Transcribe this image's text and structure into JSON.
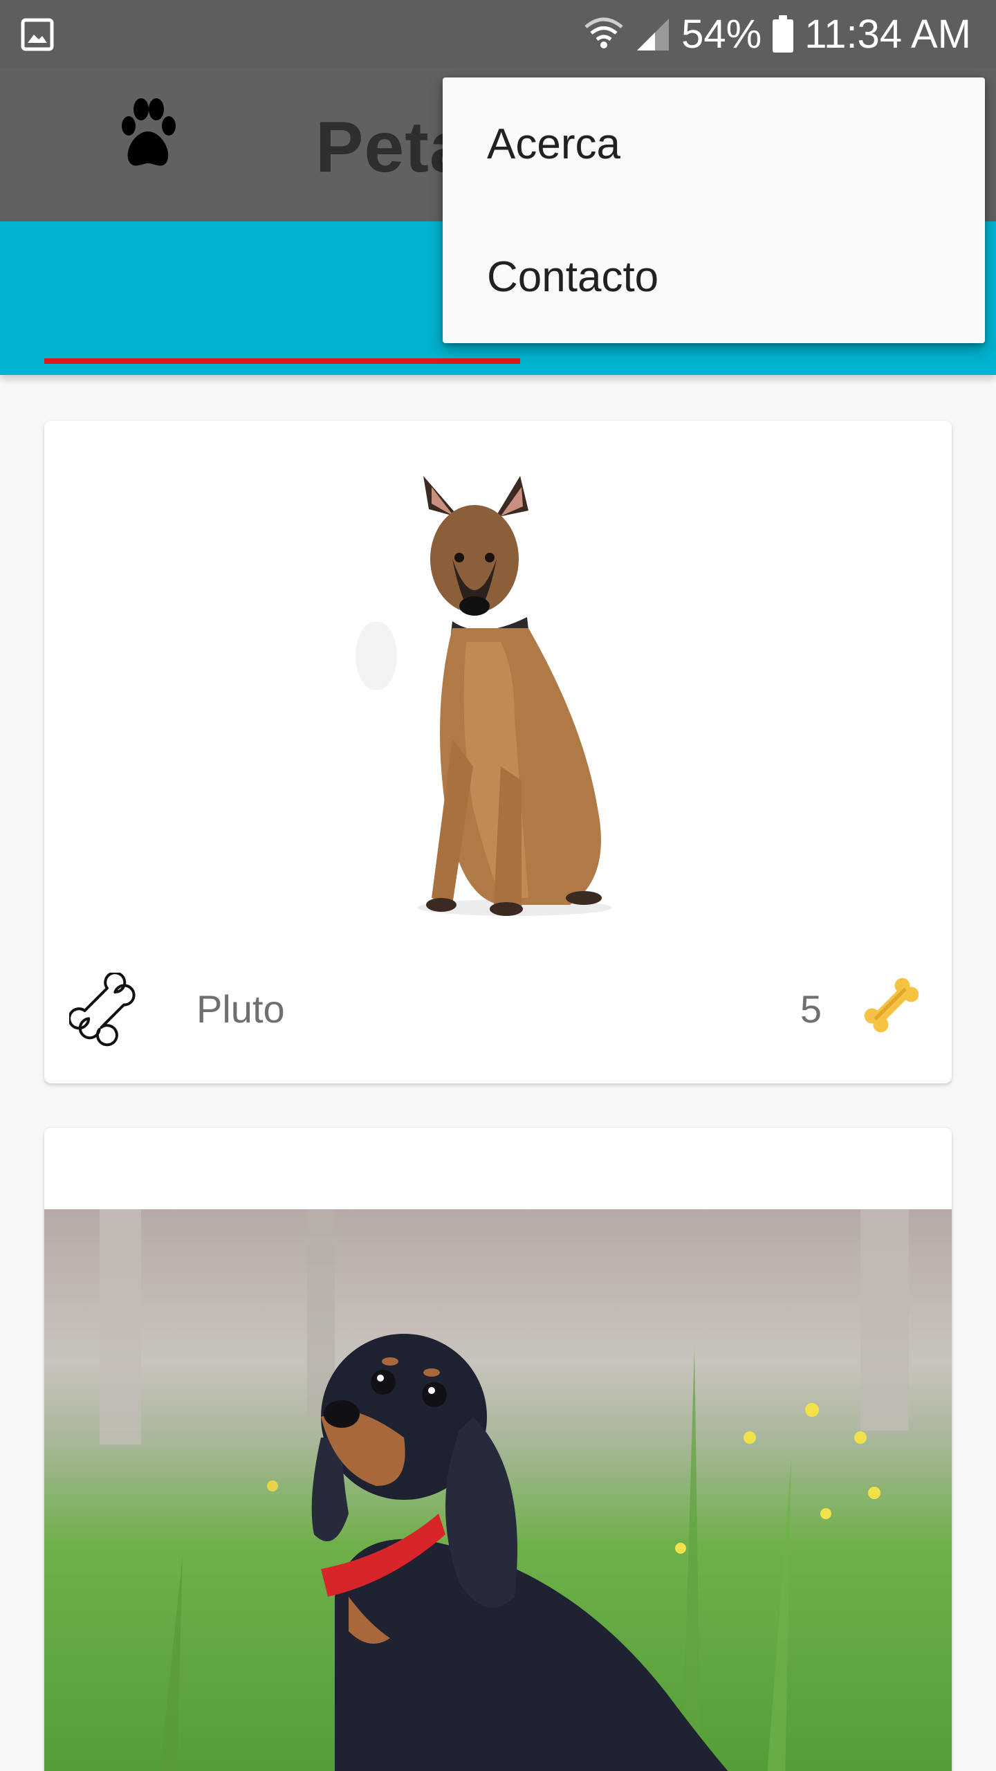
{
  "status_bar": {
    "battery": "54%",
    "time": "11:34 AM",
    "icons": [
      "image-icon",
      "wifi-icon",
      "cellular-signal-icon",
      "battery-icon"
    ]
  },
  "app_bar": {
    "title": "Peta",
    "logo_icon": "paw-icon",
    "background": "#616161"
  },
  "tabs": {
    "accent": "#00b3cf",
    "indicator_color": "#d81b1b",
    "selected_index": 0
  },
  "overflow_menu": {
    "items": [
      {
        "label": "Acerca"
      },
      {
        "label": "Contacto"
      }
    ]
  },
  "cards": [
    {
      "name": "Pluto",
      "likes": "5",
      "rate_icon": "bone-outline-icon",
      "like_icon": "bone-gold-icon"
    },
    {
      "photo": "dachshund-puppy"
    }
  ]
}
